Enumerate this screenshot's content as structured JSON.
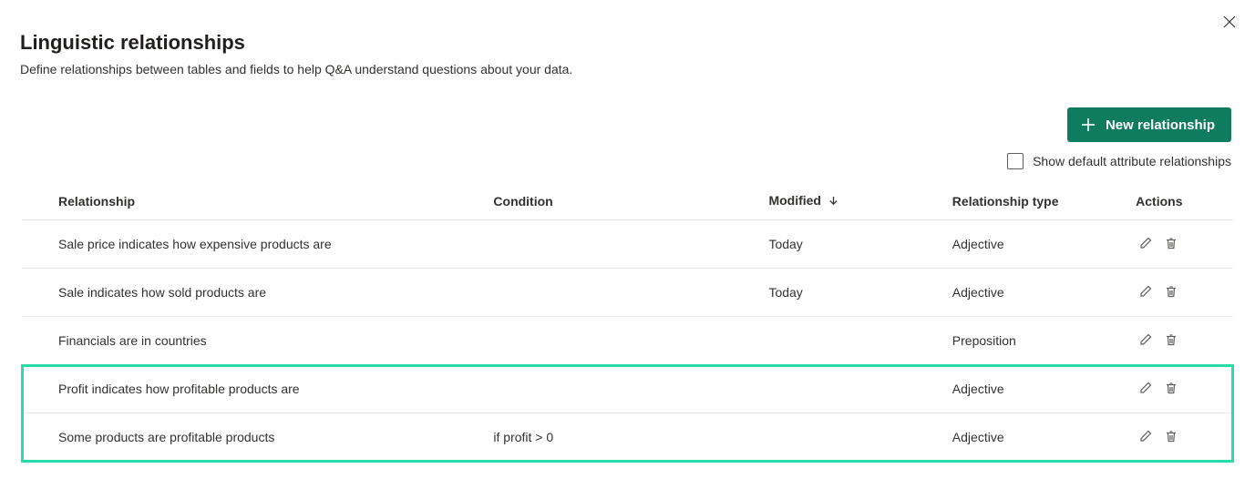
{
  "header": {
    "title": "Linguistic relationships",
    "subtitle": "Define relationships between tables and fields to help Q&A understand questions about your data."
  },
  "toolbar": {
    "new_button_label": "New relationship",
    "show_defaults_label": "Show default attribute relationships"
  },
  "table": {
    "columns": {
      "relationship": "Relationship",
      "condition": "Condition",
      "modified": "Modified",
      "type": "Relationship type",
      "actions": "Actions"
    },
    "rows": [
      {
        "relationship": "Sale price indicates how expensive products are",
        "condition": "",
        "modified": "Today",
        "type": "Adjective"
      },
      {
        "relationship": "Sale indicates how sold products are",
        "condition": "",
        "modified": "Today",
        "type": "Adjective"
      },
      {
        "relationship": "Financials are in countries",
        "condition": "",
        "modified": "",
        "type": "Preposition"
      },
      {
        "relationship": "Profit indicates how profitable products are",
        "condition": "",
        "modified": "",
        "type": "Adjective"
      },
      {
        "relationship": "Some products are profitable products",
        "condition": "if profit > 0",
        "modified": "",
        "type": "Adjective"
      }
    ]
  }
}
